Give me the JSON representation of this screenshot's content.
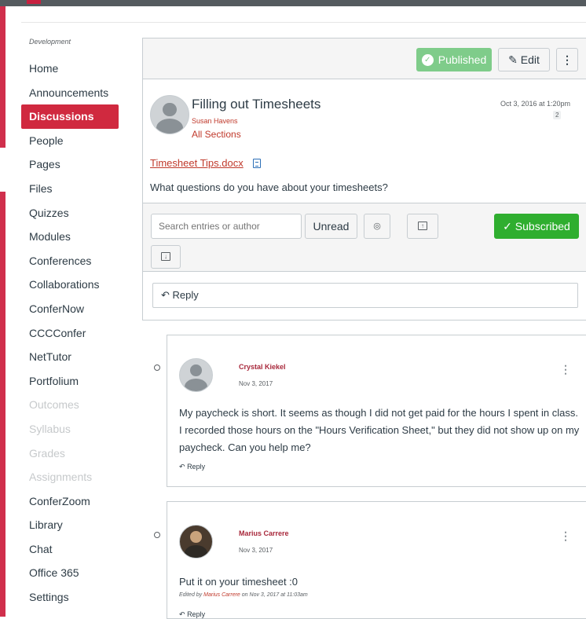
{
  "course_nav": {
    "course_name": "Development",
    "items": [
      {
        "label": "Home",
        "state": "normal"
      },
      {
        "label": "Announcements",
        "state": "normal"
      },
      {
        "label": "Discussions",
        "state": "active"
      },
      {
        "label": "People",
        "state": "normal"
      },
      {
        "label": "Pages",
        "state": "normal"
      },
      {
        "label": "Files",
        "state": "normal"
      },
      {
        "label": "Quizzes",
        "state": "normal"
      },
      {
        "label": "Modules",
        "state": "normal"
      },
      {
        "label": "Conferences",
        "state": "normal"
      },
      {
        "label": "Collaborations",
        "state": "normal"
      },
      {
        "label": "ConferNow",
        "state": "normal"
      },
      {
        "label": "CCCConfer",
        "state": "normal"
      },
      {
        "label": "NetTutor",
        "state": "normal"
      },
      {
        "label": "Portfolium",
        "state": "normal"
      },
      {
        "label": "Outcomes",
        "state": "disabled"
      },
      {
        "label": "Syllabus",
        "state": "disabled"
      },
      {
        "label": "Grades",
        "state": "disabled"
      },
      {
        "label": "Assignments",
        "state": "disabled"
      },
      {
        "label": "ConferZoom",
        "state": "normal"
      },
      {
        "label": "Library",
        "state": "normal"
      },
      {
        "label": "Chat",
        "state": "normal"
      },
      {
        "label": "Office 365",
        "state": "normal"
      },
      {
        "label": "Settings",
        "state": "normal"
      }
    ]
  },
  "toolbar": {
    "published_label": "Published",
    "edit_label": "Edit",
    "more_label": "⋮"
  },
  "post": {
    "title": "Filling out Timesheets",
    "author": "Susan Havens",
    "sections": "All Sections",
    "date": "Oct 3, 2016 at 1:20pm",
    "reply_count": "2",
    "attachment": "Timesheet Tips.docx",
    "body": "What questions do you have about your timesheets?"
  },
  "filters": {
    "search_placeholder": "Search entries or author",
    "unread_label": "Unread",
    "subscribed_label": "Subscribed"
  },
  "reply_box": {
    "label": "Reply"
  },
  "entries": [
    {
      "author": "Crystal Kiekel",
      "date": "Nov 3, 2017",
      "text": "My paycheck is short. It seems as though I did not get paid for the hours I spent in class. I recorded those hours on the \"Hours Verification Sheet,\" but they did not show up on my paycheck. Can you help me?",
      "reply_label": "Reply"
    },
    {
      "author": "Marius Carrere",
      "date": "Nov 3, 2017",
      "text": "Put it on your timesheet :0",
      "edited_prefix": "Edited by",
      "edited_by": "Marius Carrere",
      "edited_suffix": "on Nov 3, 2017 at 11:03am",
      "reply_label": "Reply"
    }
  ],
  "colors": {
    "accent_red": "#d0293f",
    "link_red": "#c0392b",
    "published_green": "#7fcc8a",
    "subscribed_green": "#2fae2f"
  }
}
